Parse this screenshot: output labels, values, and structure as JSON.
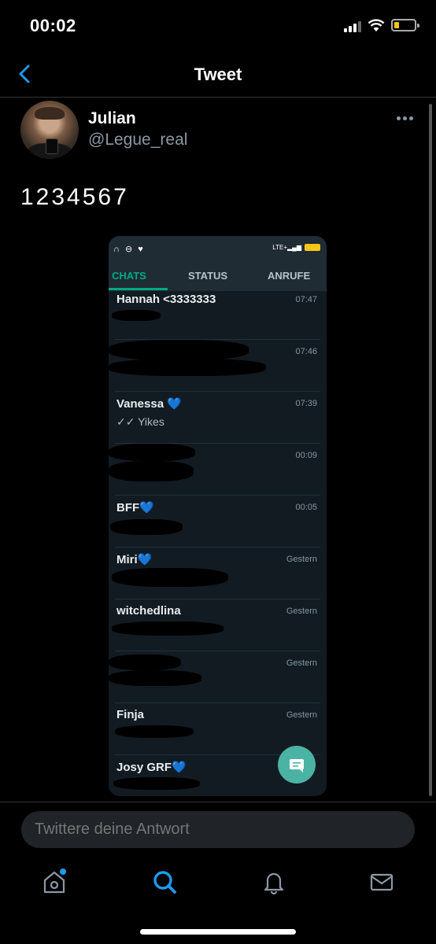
{
  "status_bar": {
    "time": "00:02"
  },
  "header": {
    "title": "Tweet"
  },
  "tweet": {
    "user_name": "Julian",
    "user_handle": "@Legue_real",
    "text": "1234567"
  },
  "embedded_screenshot": {
    "status_icons": "∩ ⊖ ♥",
    "network": "LTE+",
    "battery_label": "31",
    "tabs": [
      "CHATS",
      "STATUS",
      "ANRUFE"
    ],
    "chats": [
      {
        "name": "Hannah <3333333",
        "time": "07:47",
        "preview": ""
      },
      {
        "name": "",
        "time": "07:46",
        "preview": ""
      },
      {
        "name": "Vanessa 💙",
        "time": "07:39",
        "preview": "✓✓ Yikes"
      },
      {
        "name": "",
        "time": "00:09",
        "preview": ""
      },
      {
        "name": "BFF💙",
        "time": "00:05",
        "preview": ""
      },
      {
        "name": "Miri💙",
        "time": "Gestern",
        "preview": ""
      },
      {
        "name": "witchedlina",
        "time": "Gestern",
        "preview": ""
      },
      {
        "name": "",
        "time": "Gestern",
        "preview": ""
      },
      {
        "name": "Finja",
        "time": "Gestern",
        "preview": ""
      },
      {
        "name": "Josy GRF💙",
        "time": "",
        "preview": ""
      }
    ]
  },
  "reply": {
    "placeholder": "Twittere deine Antwort"
  },
  "tabbar": {
    "icons": [
      "home-icon",
      "search-icon",
      "notifications-icon",
      "messages-icon"
    ]
  },
  "colors": {
    "accent": "#1d9bf0",
    "whatsapp_green": "#00a884",
    "notification_dot": "#1d9bf0"
  }
}
